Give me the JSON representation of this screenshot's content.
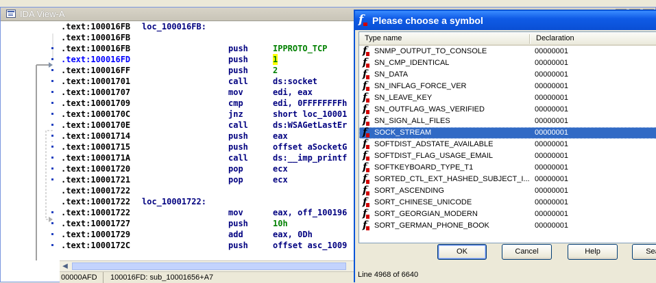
{
  "ida": {
    "title": "IDA View-A",
    "rows": [
      {
        "addr": ".text:100016FB",
        "label": "loc_100016FB:",
        "mn": "",
        "op": "",
        "opc": ""
      },
      {
        "addr": ".text:100016FB",
        "label": "",
        "mn": "",
        "op": "",
        "opc": ""
      },
      {
        "addr": ".text:100016FB",
        "label": "",
        "mn": "push",
        "op": "IPPROTO_TCP",
        "opc": "grn"
      },
      {
        "addr": ".text:100016FD",
        "label": "",
        "mn": "push",
        "op": "1",
        "opc": "yl"
      },
      {
        "addr": ".text:100016FF",
        "label": "",
        "mn": "push",
        "op": "2",
        "opc": "grn"
      },
      {
        "addr": ".text:10001701",
        "label": "",
        "mn": "call",
        "op": "ds:socket",
        "opc": ""
      },
      {
        "addr": ".text:10001707",
        "label": "",
        "mn": "mov",
        "op": "edi, eax",
        "opc": ""
      },
      {
        "addr": ".text:10001709",
        "label": "",
        "mn": "cmp",
        "op": "edi, 0FFFFFFFFh",
        "opc": ""
      },
      {
        "addr": ".text:1000170C",
        "label": "",
        "mn": "jnz",
        "op": "short loc_10001",
        "opc": ""
      },
      {
        "addr": ".text:1000170E",
        "label": "",
        "mn": "call",
        "op": "ds:WSAGetLastEr",
        "opc": ""
      },
      {
        "addr": ".text:10001714",
        "label": "",
        "mn": "push",
        "op": "eax",
        "opc": ""
      },
      {
        "addr": ".text:10001715",
        "label": "",
        "mn": "push",
        "op": "offset aSocketG",
        "opc": ""
      },
      {
        "addr": ".text:1000171A",
        "label": "",
        "mn": "call",
        "op": "ds:__imp_printf",
        "opc": ""
      },
      {
        "addr": ".text:10001720",
        "label": "",
        "mn": "pop",
        "op": "ecx",
        "opc": ""
      },
      {
        "addr": ".text:10001721",
        "label": "",
        "mn": "pop",
        "op": "ecx",
        "opc": ""
      },
      {
        "addr": ".text:10001722",
        "label": "",
        "mn": "",
        "op": "",
        "opc": ""
      },
      {
        "addr": ".text:10001722",
        "label": "loc_10001722:",
        "mn": "",
        "op": "",
        "opc": ""
      },
      {
        "addr": ".text:10001722",
        "label": "",
        "mn": "mov",
        "op": "eax, off_100196",
        "opc": ""
      },
      {
        "addr": ".text:10001727",
        "label": "",
        "mn": "push",
        "op": "10h",
        "opc": "grn"
      },
      {
        "addr": ".text:10001729",
        "label": "",
        "mn": "add",
        "op": "eax, 0Dh",
        "opc": ""
      },
      {
        "addr": ".text:1000172C",
        "label": "",
        "mn": "push",
        "op": "offset asc_1009",
        "opc": ""
      }
    ],
    "status": {
      "offset": "00000AFD",
      "location": "100016FD: sub_10001656+A7"
    }
  },
  "dialog": {
    "title": "Please choose a symbol",
    "columns": {
      "name": "Type name",
      "decl": "Declaration"
    },
    "items": [
      {
        "name": "SNMP_OUTPUT_TO_CONSOLE",
        "decl": "00000001"
      },
      {
        "name": "SN_CMP_IDENTICAL",
        "decl": "00000001"
      },
      {
        "name": "SN_DATA",
        "decl": "00000001"
      },
      {
        "name": "SN_INFLAG_FORCE_VER",
        "decl": "00000001"
      },
      {
        "name": "SN_LEAVE_KEY",
        "decl": "00000001"
      },
      {
        "name": "SN_OUTFLAG_WAS_VERIFIED",
        "decl": "00000001"
      },
      {
        "name": "SN_SIGN_ALL_FILES",
        "decl": "00000001"
      },
      {
        "name": "SOCK_STREAM",
        "decl": "00000001"
      },
      {
        "name": "SOFTDIST_ADSTATE_AVAILABLE",
        "decl": "00000001"
      },
      {
        "name": "SOFTDIST_FLAG_USAGE_EMAIL",
        "decl": "00000001"
      },
      {
        "name": "SOFTKEYBOARD_TYPE_T1",
        "decl": "00000001"
      },
      {
        "name": "SORTED_CTL_EXT_HASHED_SUBJECT_I...",
        "decl": "00000001"
      },
      {
        "name": "SORT_ASCENDING",
        "decl": "00000001"
      },
      {
        "name": "SORT_CHINESE_UNICODE",
        "decl": "00000001"
      },
      {
        "name": "SORT_GEORGIAN_MODERN",
        "decl": "00000001"
      },
      {
        "name": "SORT_GERMAN_PHONE_BOOK",
        "decl": "00000001"
      }
    ],
    "selected_name": "SOCK_STREAM",
    "buttons": {
      "ok": "OK",
      "cancel": "Cancel",
      "help": "Help",
      "search": "Sea"
    },
    "status": "Line 4968 of 6640"
  }
}
